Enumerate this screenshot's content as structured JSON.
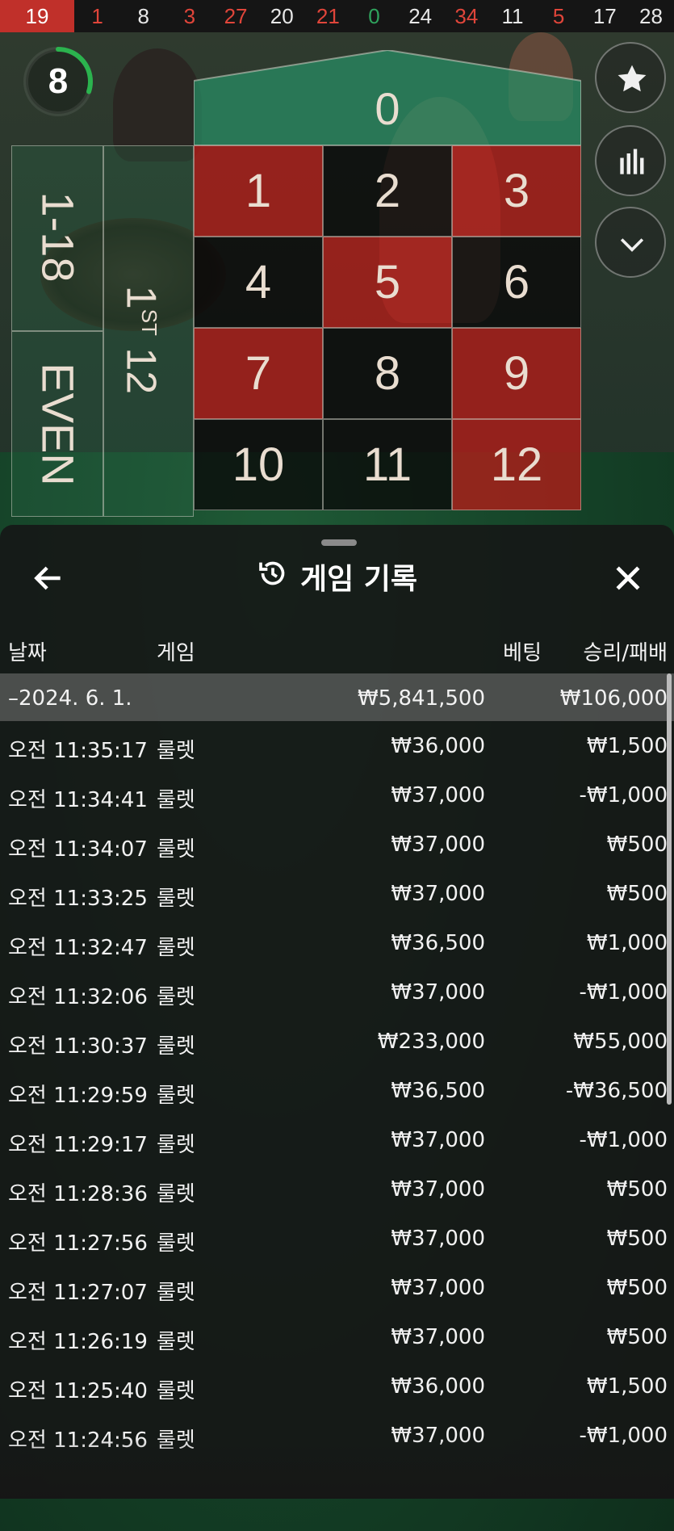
{
  "history_strip": [
    {
      "n": "19",
      "color": "red"
    },
    {
      "n": "1",
      "color": "red"
    },
    {
      "n": "8",
      "color": "black"
    },
    {
      "n": "3",
      "color": "red"
    },
    {
      "n": "27",
      "color": "red"
    },
    {
      "n": "20",
      "color": "black"
    },
    {
      "n": "21",
      "color": "red"
    },
    {
      "n": "0",
      "color": "green"
    },
    {
      "n": "24",
      "color": "black"
    },
    {
      "n": "34",
      "color": "red"
    },
    {
      "n": "11",
      "color": "black"
    },
    {
      "n": "5",
      "color": "red"
    },
    {
      "n": "17",
      "color": "black"
    },
    {
      "n": "28",
      "color": "black"
    }
  ],
  "timer": {
    "value": "8",
    "progress": 0.3
  },
  "board": {
    "zero": "0",
    "numbers": [
      {
        "n": "1",
        "c": "r"
      },
      {
        "n": "2",
        "c": "b"
      },
      {
        "n": "3",
        "c": "r"
      },
      {
        "n": "4",
        "c": "b"
      },
      {
        "n": "5",
        "c": "r"
      },
      {
        "n": "6",
        "c": "b"
      },
      {
        "n": "7",
        "c": "r"
      },
      {
        "n": "8",
        "c": "b"
      },
      {
        "n": "9",
        "c": "r"
      },
      {
        "n": "10",
        "c": "b"
      },
      {
        "n": "11",
        "c": "b"
      },
      {
        "n": "12",
        "c": "r"
      }
    ],
    "low_label": "1-18",
    "even_label": "EVEN",
    "dozen_label": "12",
    "dozen_sup": "ST",
    "dozen_prefix": "1"
  },
  "side_buttons": [
    "star-icon",
    "stats-icon",
    "chevron-down-icon"
  ],
  "panel": {
    "title": "게임 기록",
    "headers": {
      "date": "날짜",
      "game": "게임",
      "bet": "베팅",
      "result": "승리/패배"
    },
    "summary": {
      "date": "–2024. 6. 1.",
      "bet": "₩5,841,500",
      "result": "₩106,000"
    },
    "rows": [
      {
        "time": "오전 11:35:17",
        "game": "룰렛",
        "bet": "₩36,000",
        "result": "₩1,500"
      },
      {
        "time": "오전 11:34:41",
        "game": "룰렛",
        "bet": "₩37,000",
        "result": "-₩1,000"
      },
      {
        "time": "오전 11:34:07",
        "game": "룰렛",
        "bet": "₩37,000",
        "result": "₩500"
      },
      {
        "time": "오전 11:33:25",
        "game": "룰렛",
        "bet": "₩37,000",
        "result": "₩500"
      },
      {
        "time": "오전 11:32:47",
        "game": "룰렛",
        "bet": "₩36,500",
        "result": "₩1,000"
      },
      {
        "time": "오전 11:32:06",
        "game": "룰렛",
        "bet": "₩37,000",
        "result": "-₩1,000"
      },
      {
        "time": "오전 11:30:37",
        "game": "룰렛",
        "bet": "₩233,000",
        "result": "₩55,000"
      },
      {
        "time": "오전 11:29:59",
        "game": "룰렛",
        "bet": "₩36,500",
        "result": "-₩36,500"
      },
      {
        "time": "오전 11:29:17",
        "game": "룰렛",
        "bet": "₩37,000",
        "result": "-₩1,000"
      },
      {
        "time": "오전 11:28:36",
        "game": "룰렛",
        "bet": "₩37,000",
        "result": "₩500"
      },
      {
        "time": "오전 11:27:56",
        "game": "룰렛",
        "bet": "₩37,000",
        "result": "₩500"
      },
      {
        "time": "오전 11:27:07",
        "game": "룰렛",
        "bet": "₩37,000",
        "result": "₩500"
      },
      {
        "time": "오전 11:26:19",
        "game": "룰렛",
        "bet": "₩37,000",
        "result": "₩500"
      },
      {
        "time": "오전 11:25:40",
        "game": "룰렛",
        "bet": "₩36,000",
        "result": "₩1,500"
      },
      {
        "time": "오전 11:24:56",
        "game": "룰렛",
        "bet": "₩37,000",
        "result": "-₩1,000"
      }
    ]
  },
  "colors": {
    "red": "#c0302a",
    "board_red": "#b41c18",
    "green": "#2fa35d",
    "panel_bg": "#161616"
  }
}
